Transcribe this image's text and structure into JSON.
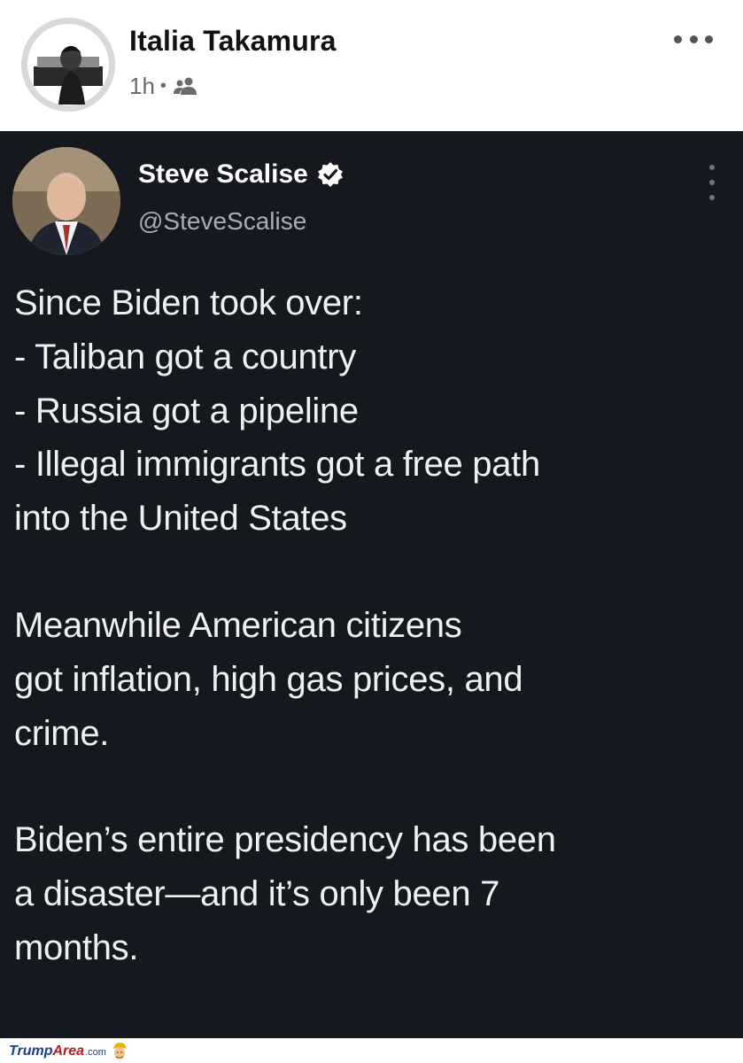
{
  "post": {
    "author": "Italia Takamura",
    "time": "1h",
    "separator": "•",
    "audience_icon": "friends-icon",
    "more_icon": "more-horizontal-icon"
  },
  "tweet": {
    "display_name": "Steve Scalise",
    "handle": "@SteveScalise",
    "verified_icon": "verified-badge-icon",
    "menu_icon": "more-vertical-icon",
    "paragraphs": [
      [
        "Since Biden took over:",
        "- Taliban got a country",
        "- Russia got a pipeline",
        "- Illegal immigrants got a free path",
        "into the United States"
      ],
      [
        "Meanwhile American citizens",
        "got inflation, high gas prices, and",
        "crime."
      ],
      [
        "Biden’s entire presidency has been",
        "a disaster—and it’s only been 7",
        "months."
      ]
    ]
  },
  "watermark": {
    "brand_part1": "Trump",
    "brand_part2": "Area",
    "domain_suffix": ".com"
  },
  "colors": {
    "tweet_background": "#16181f",
    "tweet_text": "#eef0f2",
    "handle_text": "#a8adb5",
    "watermark_blue": "#1b3f8f",
    "watermark_red": "#b51d1d"
  }
}
